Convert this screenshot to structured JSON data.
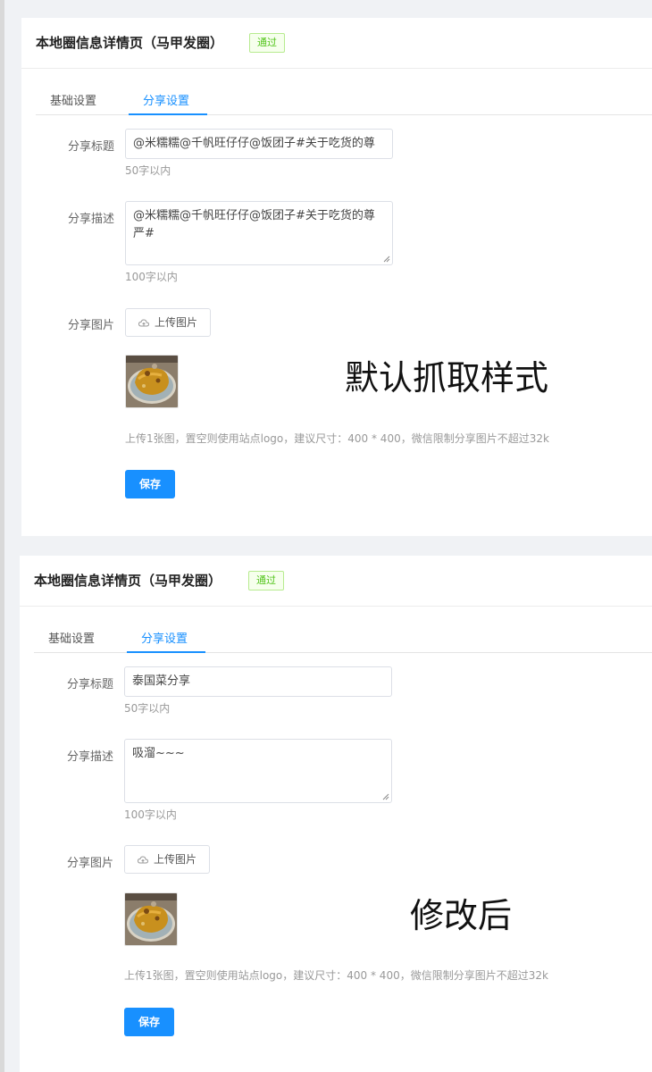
{
  "panels": [
    {
      "title": "本地圈信息详情页（马甲发圈）",
      "badge": "通过",
      "tabs": [
        "基础设置",
        "分享设置"
      ],
      "share_title_label": "分享标题",
      "share_title_value": "@米糯糯@千帆旺仔仔@饭团子#关于吃货的尊",
      "share_title_help": "50字以内",
      "share_desc_label": "分享描述",
      "share_desc_value": "@米糯糯@千帆旺仔仔@饭团子#关于吃货的尊严#",
      "share_desc_help": "100字以内",
      "share_image_label": "分享图片",
      "upload_button": "上传图片",
      "image_help": "上传1张图，置空则使用站点logo，建议尺寸：400 * 400，微信限制分享图片不超过32k",
      "save_button": "保存",
      "overlay_note": "默认抓取样式"
    },
    {
      "title": "本地圈信息详情页（马甲发圈）",
      "badge": "通过",
      "tabs": [
        "基础设置",
        "分享设置"
      ],
      "share_title_label": "分享标题",
      "share_title_value": "泰国菜分享",
      "share_title_help": "50字以内",
      "share_desc_label": "分享描述",
      "share_desc_value": "吸溜~~~",
      "share_desc_help": "100字以内",
      "share_image_label": "分享图片",
      "upload_button": "上传图片",
      "image_help": "上传1张图，置空则使用站点logo，建议尺寸：400 * 400，微信限制分享图片不超过32k",
      "save_button": "保存",
      "overlay_note": "修改后"
    }
  ],
  "colors": {
    "accent": "#1890ff",
    "badge_green": "#52c41a",
    "help_gray": "#999999"
  },
  "icons": {
    "upload": "cloud-upload-icon"
  }
}
